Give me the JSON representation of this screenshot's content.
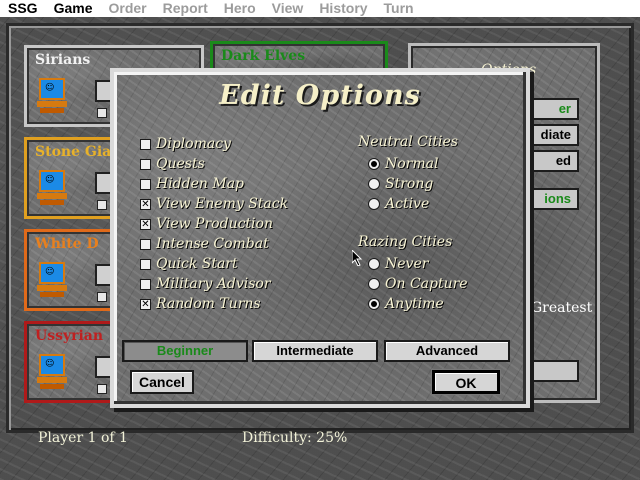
{
  "menubar": {
    "items": [
      "SSG",
      "Game",
      "Order",
      "Report",
      "Hero",
      "View",
      "History",
      "Turn"
    ]
  },
  "players": [
    {
      "name": "Sirians",
      "color": "#c8c8c8"
    },
    {
      "name": "Stone Gia",
      "color": "#e0a020"
    },
    {
      "name": "White D",
      "color": "#e06a1a"
    },
    {
      "name": "Ussyrian",
      "color": "#b01a1a"
    }
  ],
  "extra_card": {
    "name": "Dark Elves",
    "color": "#1a8a1a"
  },
  "right_panel": {
    "title": "Options",
    "buttons": [
      "er",
      "diate",
      "ed",
      "ions"
    ],
    "greatest_label": "Greatest"
  },
  "footer": {
    "player_text": "Player 1 of 1",
    "difficulty_text": "Difficulty: 25%"
  },
  "dialog": {
    "title": "Edit Options",
    "options": [
      {
        "label": "Diplomacy",
        "checked": false
      },
      {
        "label": "Quests",
        "checked": false
      },
      {
        "label": "Hidden Map",
        "checked": false
      },
      {
        "label": "View Enemy Stack",
        "checked": true
      },
      {
        "label": "View Production",
        "checked": true
      },
      {
        "label": "Intense Combat",
        "checked": false
      },
      {
        "label": "Quick Start",
        "checked": false
      },
      {
        "label": "Military Advisor",
        "checked": false
      },
      {
        "label": "Random Turns",
        "checked": true
      }
    ],
    "neutral_cities": {
      "title": "Neutral Cities",
      "options": [
        "Normal",
        "Strong",
        "Active"
      ],
      "selected": "Normal"
    },
    "razing_cities": {
      "title": "Razing Cities",
      "options": [
        "Never",
        "On Capture",
        "Anytime"
      ],
      "selected": "Anytime"
    },
    "levels": [
      "Beginner",
      "Intermediate",
      "Advanced"
    ],
    "selected_level": "Beginner",
    "cancel_label": "Cancel",
    "ok_label": "OK",
    "check_mark": "✕"
  }
}
